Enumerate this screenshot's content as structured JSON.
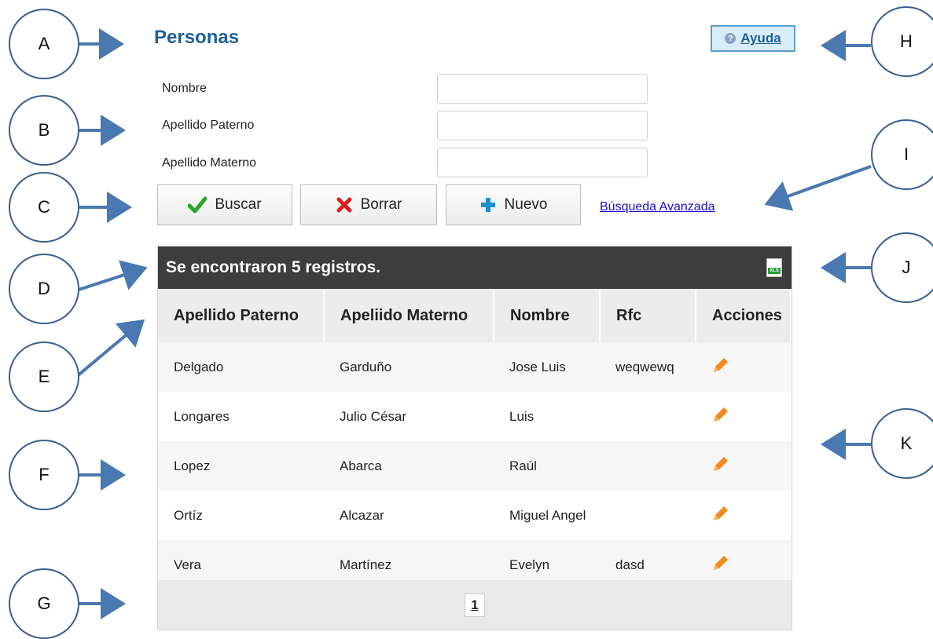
{
  "callouts": [
    "A",
    "B",
    "C",
    "D",
    "E",
    "F",
    "G",
    "H",
    "I",
    "J",
    "K"
  ],
  "title": "Personas",
  "help": {
    "label": "Ayuda"
  },
  "form": {
    "fields": [
      {
        "label": "Nombre",
        "value": ""
      },
      {
        "label": "Apellido Paterno",
        "value": ""
      },
      {
        "label": "Apellido Materno",
        "value": ""
      }
    ]
  },
  "buttons": {
    "search": "Buscar",
    "clear": "Borrar",
    "new": "Nuevo",
    "advanced": "Búsqueda Avanzada"
  },
  "results": {
    "summary": "Se encontraron 5 registros.",
    "columns": [
      "Apellido Paterno",
      "Apeliido Materno",
      "Nombre",
      "Rfc",
      "Acciones"
    ],
    "rows": [
      [
        "Delgado",
        "Garduño",
        "Jose Luis",
        "weqwewq"
      ],
      [
        "Longares",
        "Julio César",
        "Luis",
        ""
      ],
      [
        "Lopez",
        "Abarca",
        "Raúl",
        ""
      ],
      [
        "Ortíz",
        "Alcazar",
        "Miguel Angel",
        ""
      ],
      [
        "Vera",
        "Martínez",
        "Evelyn",
        "dasd"
      ]
    ],
    "page": "1"
  },
  "colors": {
    "title": "#1f5f99",
    "header_bar": "#3d3d3d",
    "pencil": "#f28a1e",
    "check": "#2aa52a",
    "cross": "#d92020",
    "plus": "#1d8fd1"
  }
}
